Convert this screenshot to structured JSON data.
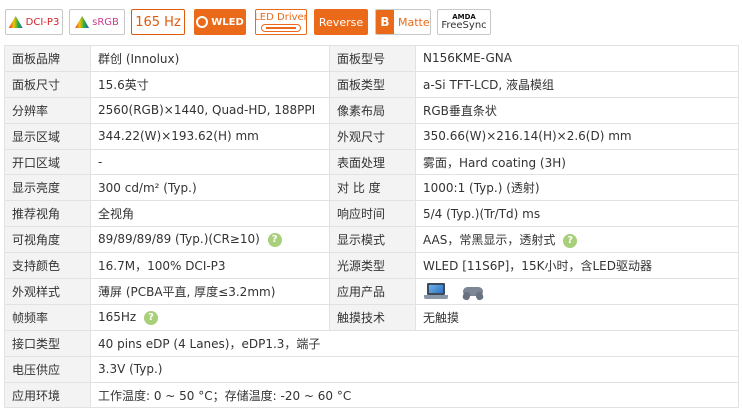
{
  "badges": {
    "dci": "DCI-P3",
    "srgb": "sRGB",
    "hz": "165 Hz",
    "wled": "WLED",
    "led_driver": "LED Driver",
    "reverse": "Reverse",
    "matte_letter": "B",
    "matte": "Matte",
    "amd": "AMDA",
    "freesync": "FreeSync"
  },
  "specs": {
    "r1": {
      "k1": "面板品牌",
      "v1": "群创 (Innolux)",
      "k2": "面板型号",
      "v2": "N156KME-GNA"
    },
    "r2": {
      "k1": "面板尺寸",
      "v1": "15.6英寸",
      "k2": "面板类型",
      "v2": "a-Si TFT-LCD, 液晶模组"
    },
    "r3": {
      "k1": "分辨率",
      "v1": "2560(RGB)×1440, Quad-HD, 188PPI",
      "k2": "像素布局",
      "v2": "RGB垂直条状"
    },
    "r4": {
      "k1": "显示区域",
      "v1": "344.22(W)×193.62(H) mm",
      "k2": "外观尺寸",
      "v2": "350.66(W)×216.14(H)×2.6(D) mm"
    },
    "r5": {
      "k1": "开口区域",
      "v1": "-",
      "k2": "表面处理",
      "v2": "雾面，Hard coating (3H)"
    },
    "r6": {
      "k1": "显示亮度",
      "v1": "300 cd/m² (Typ.)",
      "k2": "对 比 度",
      "v2": "1000:1 (Typ.) (透射)"
    },
    "r7": {
      "k1": "推荐视角",
      "v1": "全视角",
      "k2": "响应时间",
      "v2": "5/4 (Typ.)(Tr/Td) ms"
    },
    "r8": {
      "k1": "可视角度",
      "v1": "89/89/89/89 (Typ.)(CR≥10)",
      "k2": "显示模式",
      "v2": "AAS，常黑显示，透射式"
    },
    "r9": {
      "k1": "支持颜色",
      "v1": "16.7M，100% DCI-P3",
      "k2": "光源类型",
      "v2": "WLED [11S6P]，15K小时，含LED驱动器"
    },
    "r10": {
      "k1": "外观样式",
      "v1": "薄屏 (PCBA平直, 厚度≤3.2mm)",
      "k2": "应用产品"
    },
    "r11": {
      "k1": "帧频率",
      "v1": "165Hz",
      "k2": "触摸技术",
      "v2": "无触摸"
    },
    "r12": {
      "k1": "接口类型",
      "v1": "40 pins  eDP (4 Lanes)，eDP1.3，端子"
    },
    "r13": {
      "k1": "电压供应",
      "v1": "3.3V (Typ.)"
    },
    "r14": {
      "k1": "应用环境",
      "v1": "工作温度: 0 ~ 50 °C；存储温度: -20 ~ 60 °C"
    }
  },
  "help_symbol": "?",
  "icons": {
    "help": "help-circle-icon",
    "laptop": "laptop-icon",
    "gamepad": "gamepad-icon"
  }
}
